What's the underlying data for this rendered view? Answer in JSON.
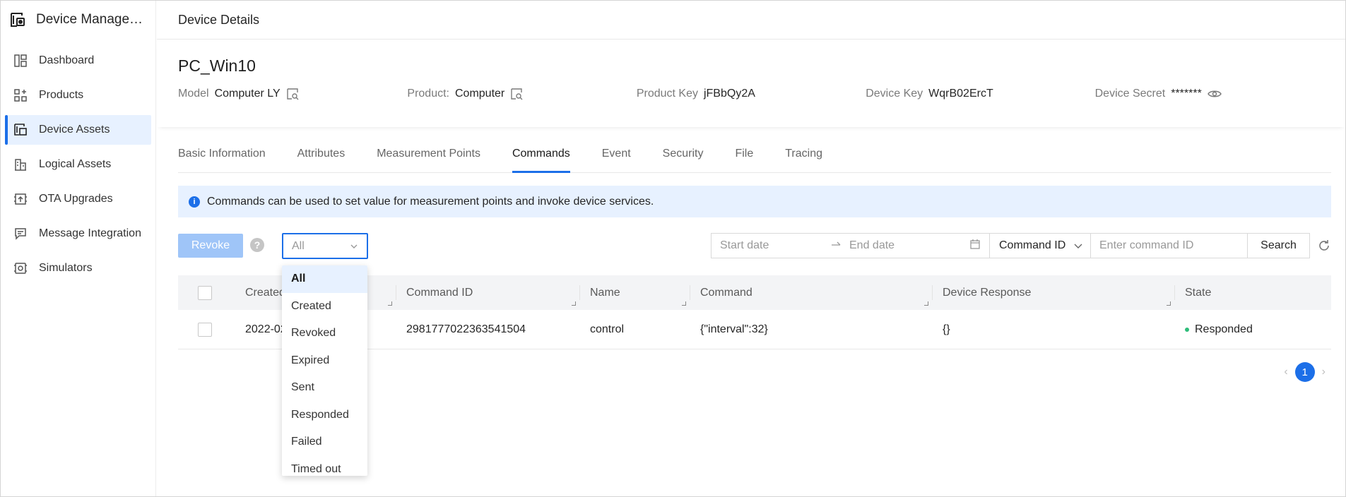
{
  "sidebar": {
    "app_title": "Device Management",
    "items": [
      {
        "label": "Dashboard",
        "icon": "dashboard-icon"
      },
      {
        "label": "Products",
        "icon": "products-icon"
      },
      {
        "label": "Device Assets",
        "icon": "device-assets-icon",
        "active": true
      },
      {
        "label": "Logical Assets",
        "icon": "logical-assets-icon"
      },
      {
        "label": "OTA Upgrades",
        "icon": "ota-icon"
      },
      {
        "label": "Message Integration",
        "icon": "message-icon"
      },
      {
        "label": "Simulators",
        "icon": "simulator-icon"
      }
    ]
  },
  "header": {
    "title": "Device Details"
  },
  "device": {
    "name": "PC_Win10",
    "model_label": "Model",
    "model_value": "Computer LY",
    "product_label": "Product:",
    "product_value": "Computer",
    "product_key_label": "Product Key",
    "product_key_value": "jFBbQy2A",
    "device_key_label": "Device Key",
    "device_key_value": "WqrB02ErcT",
    "device_secret_label": "Device Secret",
    "device_secret_value": "*******"
  },
  "tabs": [
    "Basic Information",
    "Attributes",
    "Measurement Points",
    "Commands",
    "Event",
    "Security",
    "File",
    "Tracing"
  ],
  "active_tab": "Commands",
  "notice": "Commands can be used to set value for measurement points and invoke device services.",
  "toolbar": {
    "revoke_label": "Revoke",
    "help_glyph": "?",
    "state_select_value": "All",
    "start_date_placeholder": "Start date",
    "end_date_placeholder": "End date",
    "search_field_select": "Command ID",
    "command_input_placeholder": "Enter command ID",
    "search_label": "Search"
  },
  "table": {
    "headers": [
      "Created",
      "Command ID",
      "Name",
      "Command",
      "Device Response",
      "State"
    ],
    "rows": [
      {
        "created": "2022-02",
        "command_id": "2981777022363541504",
        "name": "control",
        "command": "{\"interval\":32}",
        "response": "{}",
        "state": "Responded"
      }
    ]
  },
  "pagination": {
    "current": "1",
    "prev": "‹",
    "next": "›"
  },
  "dropdown": {
    "options": [
      "All",
      "Created",
      "Revoked",
      "Expired",
      "Sent",
      "Responded",
      "Failed",
      "Timed out"
    ],
    "selected": "All"
  },
  "colors": {
    "accent": "#1c6fe8",
    "notice_bg": "#e7f1ff",
    "success": "#2ebd7a"
  }
}
